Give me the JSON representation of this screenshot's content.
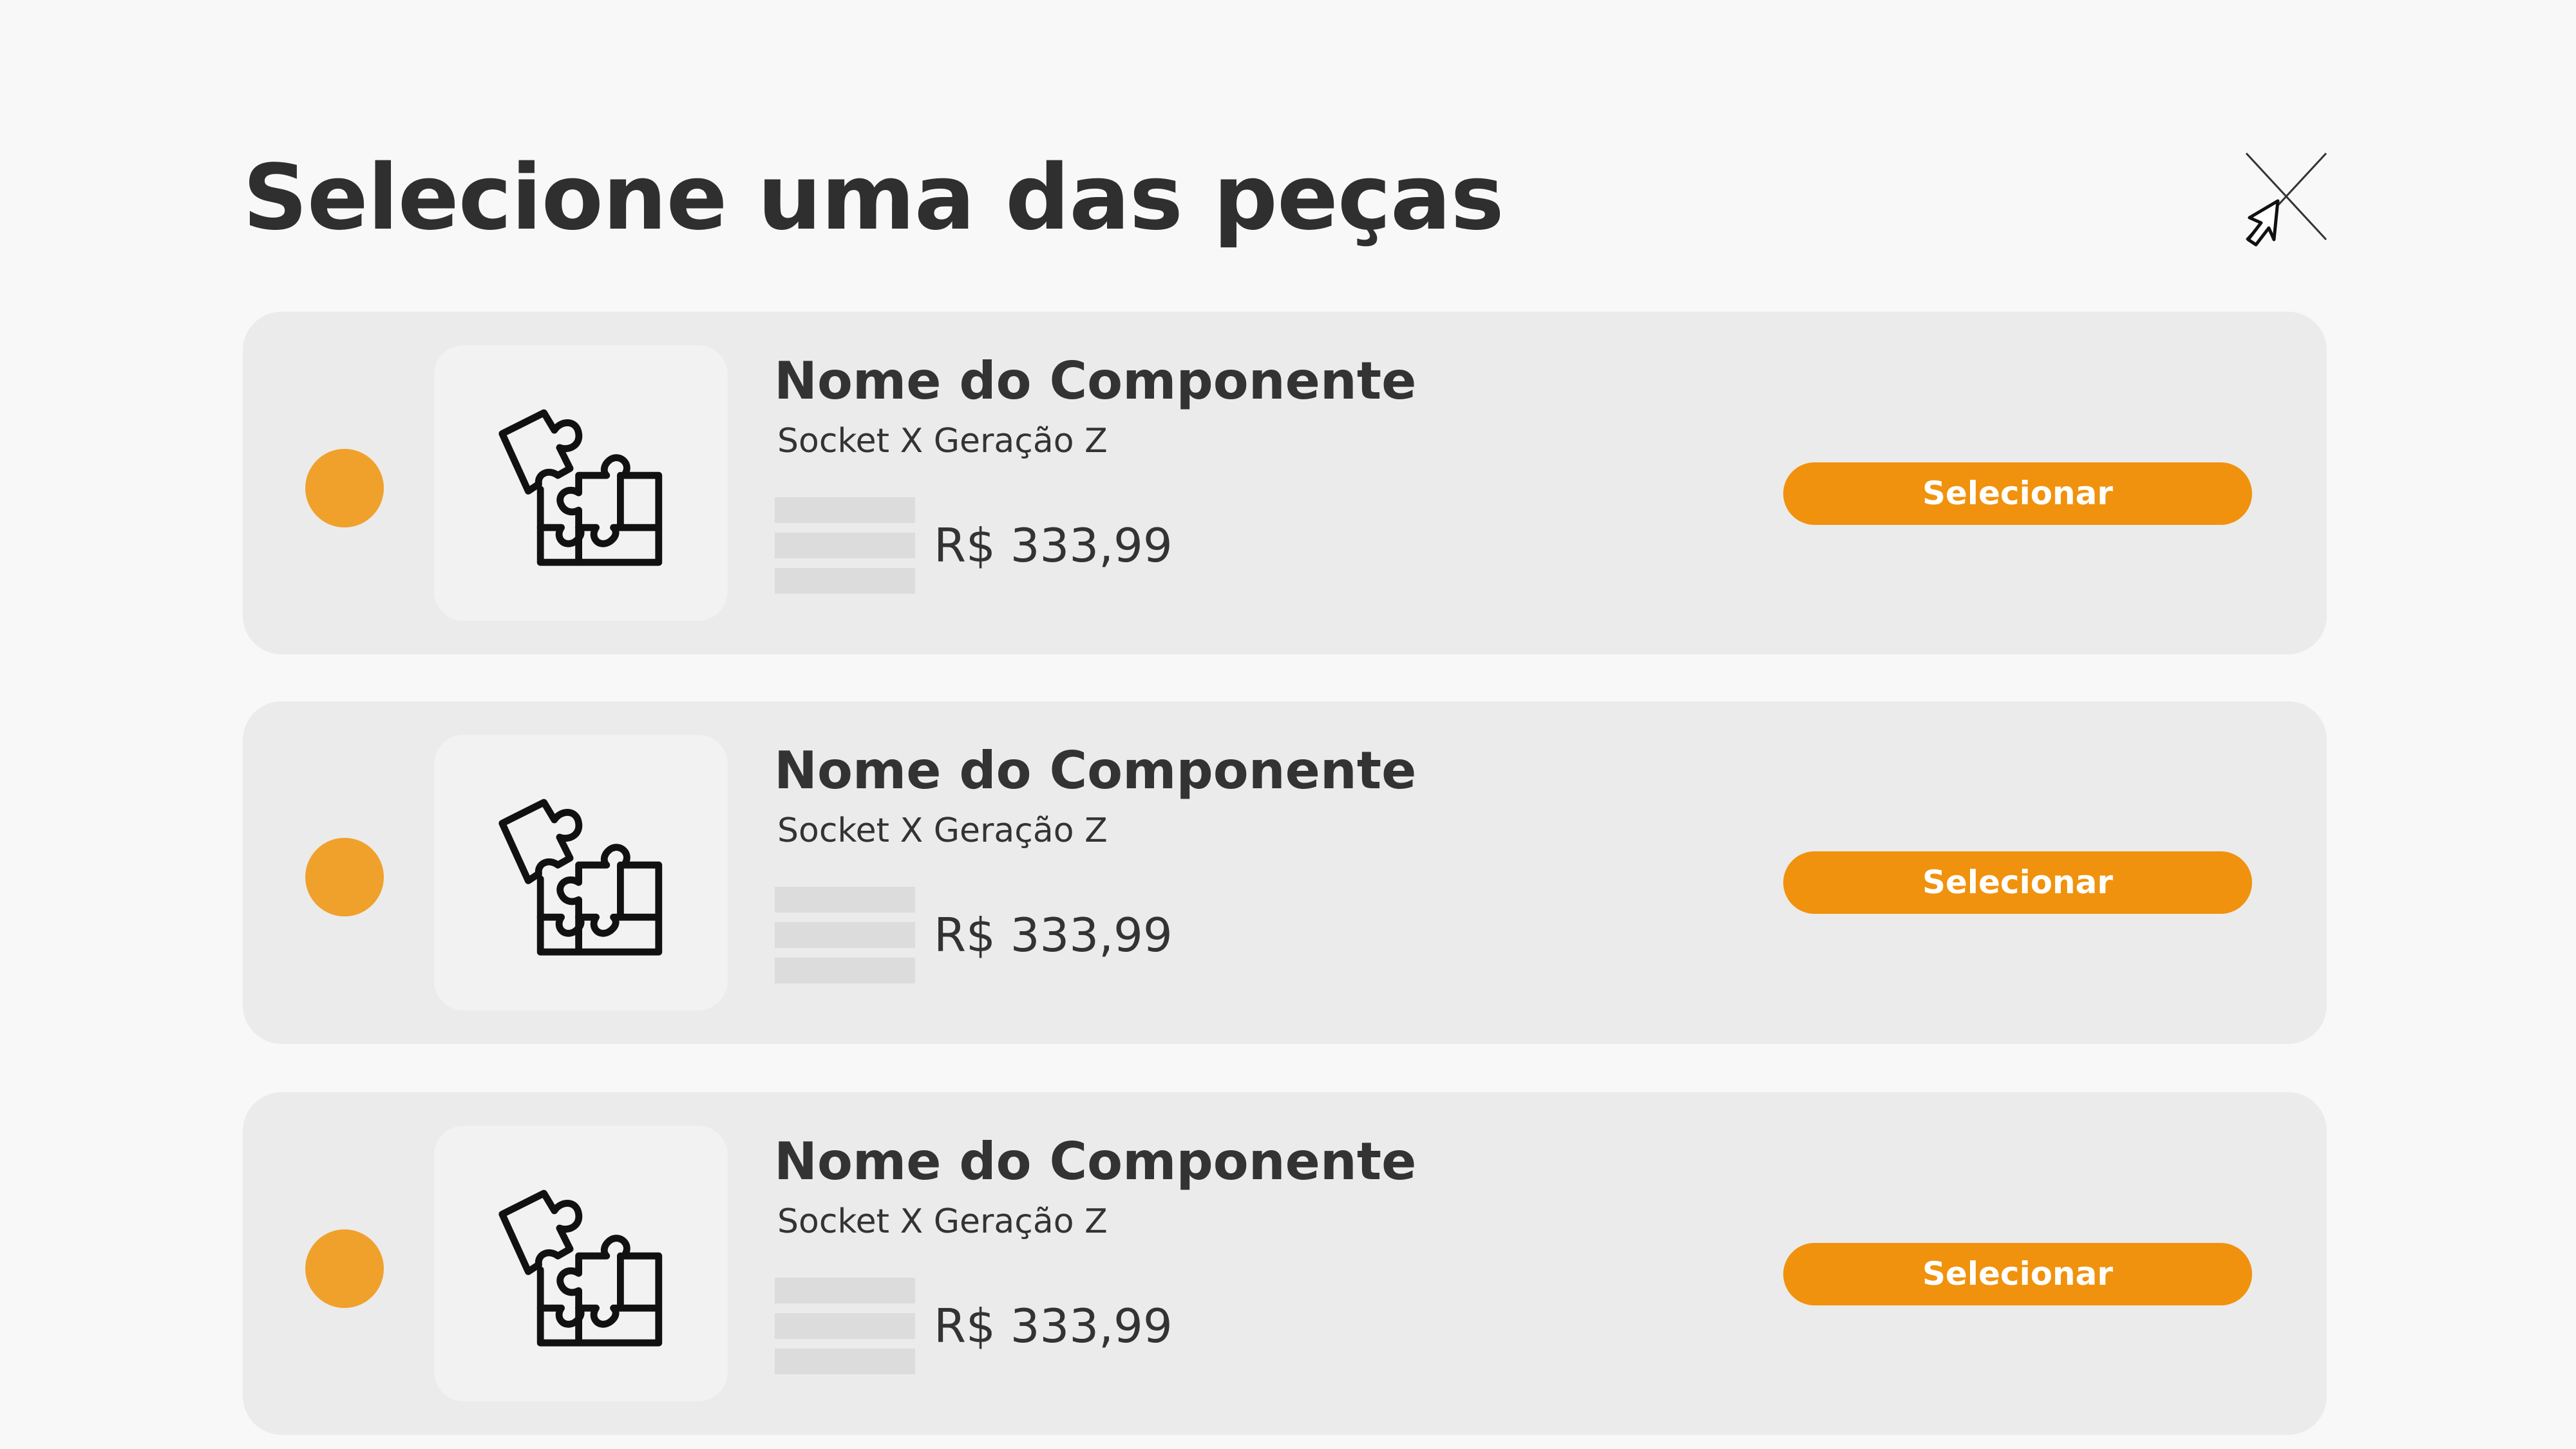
{
  "header": {
    "title": "Selecione uma das peças"
  },
  "colors": {
    "accent": "#f0920d",
    "radio": "#f0a12b",
    "card_bg": "#ebebeb",
    "page_bg": "#f8f8f8"
  },
  "icons": {
    "close": "close-icon",
    "component": "puzzle-icon",
    "cursor": "mouse-pointer-icon"
  },
  "items": [
    {
      "name": "Nome do Componente",
      "subtitle": "Socket X Geração Z",
      "price": "R$ 333,99",
      "button_label": "Selecionar"
    },
    {
      "name": "Nome do Componente",
      "subtitle": "Socket X Geração Z",
      "price": "R$ 333,99",
      "button_label": "Selecionar"
    },
    {
      "name": "Nome do Componente",
      "subtitle": "Socket X Geração Z",
      "price": "R$ 333,99",
      "button_label": "Selecionar"
    }
  ]
}
